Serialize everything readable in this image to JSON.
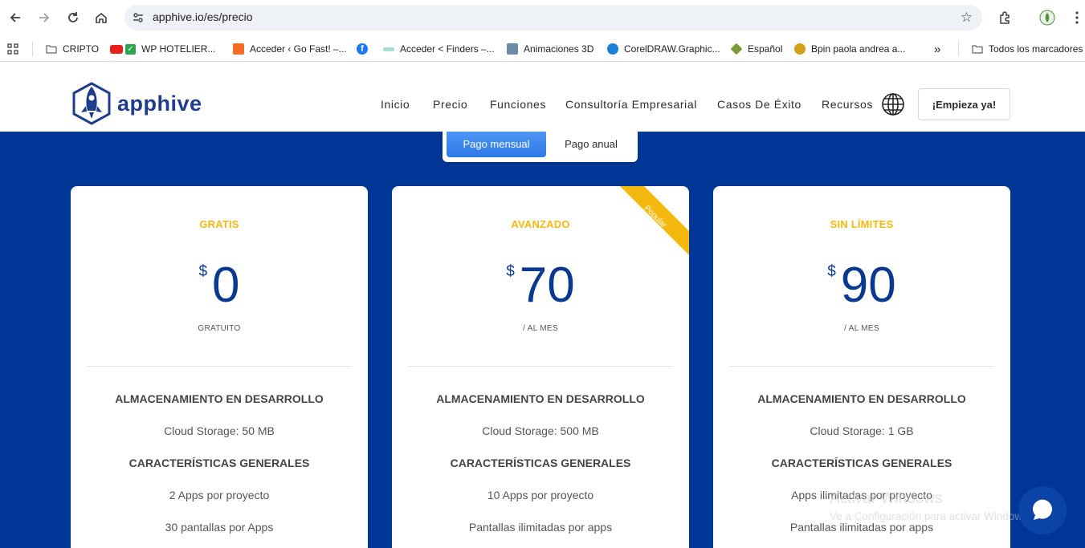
{
  "browser": {
    "url": "apphive.io/es/precio",
    "bookmarks": [
      {
        "label": "CRIPTO",
        "icon": "folder-icon",
        "color": "#5f6368"
      },
      {
        "label": "WP HOTELIER...",
        "icon": "youtube-check-icon",
        "color": "#e62117"
      },
      {
        "label": "Acceder ‹ Go Fast! –...",
        "icon": "gofast-icon",
        "color": "#f26c25"
      },
      {
        "label": "Acceder < Finders –...",
        "icon": "finders-icon",
        "color": "#3aa59c"
      },
      {
        "label": "Animaciones 3D",
        "icon": "animaciones-icon",
        "color": "#6b8aa6"
      },
      {
        "label": "CorelDRAW.Graphic...",
        "icon": "coreldraw-icon",
        "color": "#1d7fd6"
      },
      {
        "label": "Español",
        "icon": "espanol-icon",
        "color": "#7a9a3a"
      },
      {
        "label": "Bpin paola andrea a...",
        "icon": "bpin-icon",
        "color": "#d4a017"
      }
    ],
    "all_bookmarks": "Todos los marcadores",
    "overflow": "»"
  },
  "site": {
    "brand": "apphive",
    "nav": [
      "Inicio",
      "Precio",
      "Funciones",
      "Consultoría Empresarial",
      "Casos De Éxito",
      "Recursos"
    ],
    "cta": "¡Empieza ya!"
  },
  "billing": {
    "monthly": "Pago mensual",
    "annual": "Pago anual"
  },
  "plans": [
    {
      "name": "GRATIS",
      "currency": "$",
      "price": "0",
      "period": "GRATUITO",
      "features": [
        {
          "text": "ALMACENAMIENTO EN DESARROLLO",
          "header": true
        },
        {
          "text": "Cloud Storage: 50 MB",
          "header": false
        },
        {
          "text": "CARACTERÍSTICAS GENERALES",
          "header": true
        },
        {
          "text": "2 Apps por proyecto",
          "header": false
        },
        {
          "text": "30 pantallas por Apps",
          "header": false
        }
      ]
    },
    {
      "name": "AVANZADO",
      "currency": "$",
      "price": "70",
      "period": "/ AL MES",
      "ribbon": "Popular",
      "features": [
        {
          "text": "ALMACENAMIENTO EN DESARROLLO",
          "header": true
        },
        {
          "text": "Cloud Storage: 500 MB",
          "header": false
        },
        {
          "text": "CARACTERÍSTICAS GENERALES",
          "header": true
        },
        {
          "text": "10 Apps por proyecto",
          "header": false
        },
        {
          "text": "Pantallas ilimitadas por apps",
          "header": false
        }
      ]
    },
    {
      "name": "SIN LÍMITES",
      "currency": "$",
      "price": "90",
      "period": "/ AL MES",
      "features": [
        {
          "text": "ALMACENAMIENTO EN DESARROLLO",
          "header": true
        },
        {
          "text": "Cloud Storage: 1 GB",
          "header": false
        },
        {
          "text": "CARACTERÍSTICAS GENERALES",
          "header": true
        },
        {
          "text": "Apps ilimitadas por proyecto",
          "header": false
        },
        {
          "text": "Pantallas ilimitadas por apps",
          "header": false
        }
      ]
    }
  ],
  "watermark": {
    "title": "Activar Windows",
    "subtitle": "Ve a Configuración para activar Windows."
  },
  "colors": {
    "accent_blue": "#003797",
    "plan_gold": "#f5b80f",
    "toggle_blue": "#3a85ef"
  }
}
